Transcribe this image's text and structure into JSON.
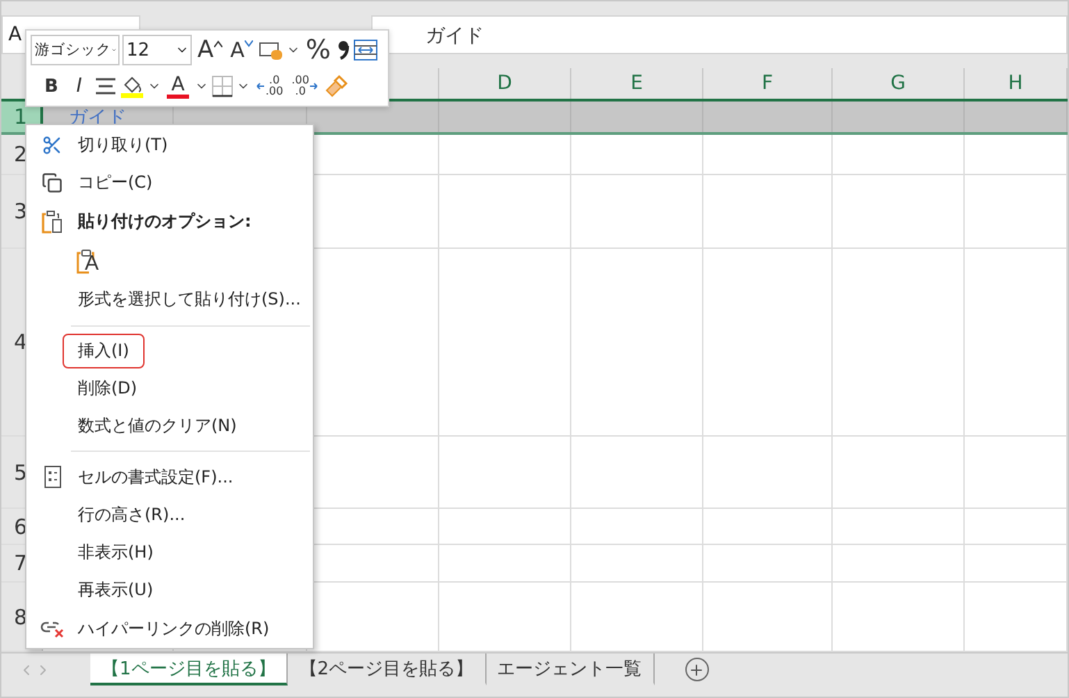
{
  "name_box": "A",
  "formula": "ガイド",
  "columns": [
    {
      "label": "D"
    },
    {
      "label": "E"
    },
    {
      "label": "F"
    },
    {
      "label": "G"
    },
    {
      "label": "H"
    }
  ],
  "rows": [
    {
      "number": "1",
      "selected": true,
      "cell_a": "ガイド"
    },
    {
      "number": "2",
      "selected": false
    },
    {
      "number": "3",
      "selected": false
    },
    {
      "number": "4",
      "selected": false
    },
    {
      "number": "5",
      "selected": false
    },
    {
      "number": "6",
      "selected": false
    },
    {
      "number": "7",
      "selected": false
    },
    {
      "number": "8",
      "selected": false
    }
  ],
  "mini_toolbar": {
    "font": "游ゴシック",
    "size": "12",
    "bold": "B",
    "italic": "I",
    "font_color": "A",
    "grow_font": "A",
    "shrink_font": "A",
    "percent": "%",
    "decimal_increase": {
      "top": ".0",
      "bottom": ".00"
    },
    "decimal_decrease": {
      "top": ".00",
      "bottom": ".0"
    }
  },
  "context_menu": {
    "items": [
      {
        "kind": "command",
        "label": "切り取り(T)",
        "highlighted": false
      },
      {
        "kind": "command",
        "label": "コピー(C)",
        "highlighted": false
      },
      {
        "kind": "heading",
        "label": "貼り付けのオプション:"
      },
      {
        "kind": "paste-option",
        "letter": "A"
      },
      {
        "kind": "command",
        "label": "形式を選択して貼り付け(S)...",
        "highlighted": false
      },
      {
        "kind": "separator"
      },
      {
        "kind": "command",
        "label": "挿入(I)",
        "highlighted": true
      },
      {
        "kind": "command",
        "label": "削除(D)",
        "highlighted": false
      },
      {
        "kind": "command",
        "label": "数式と値のクリア(N)",
        "highlighted": false
      },
      {
        "kind": "separator"
      },
      {
        "kind": "command",
        "label": "セルの書式設定(F)...",
        "highlighted": false
      },
      {
        "kind": "command",
        "label": "行の高さ(R)...",
        "highlighted": false
      },
      {
        "kind": "command",
        "label": "非表示(H)",
        "highlighted": false
      },
      {
        "kind": "command",
        "label": "再表示(U)",
        "highlighted": false
      },
      {
        "kind": "command",
        "label": "ハイパーリンクの削除(R)",
        "highlighted": false
      }
    ]
  },
  "sheet_tabs": [
    {
      "label": "【1ページ目を貼る】",
      "selected": true
    },
    {
      "label": "【2ページ目を貼る】",
      "selected": false
    },
    {
      "label": "エージェント一覧",
      "selected": false
    }
  ]
}
